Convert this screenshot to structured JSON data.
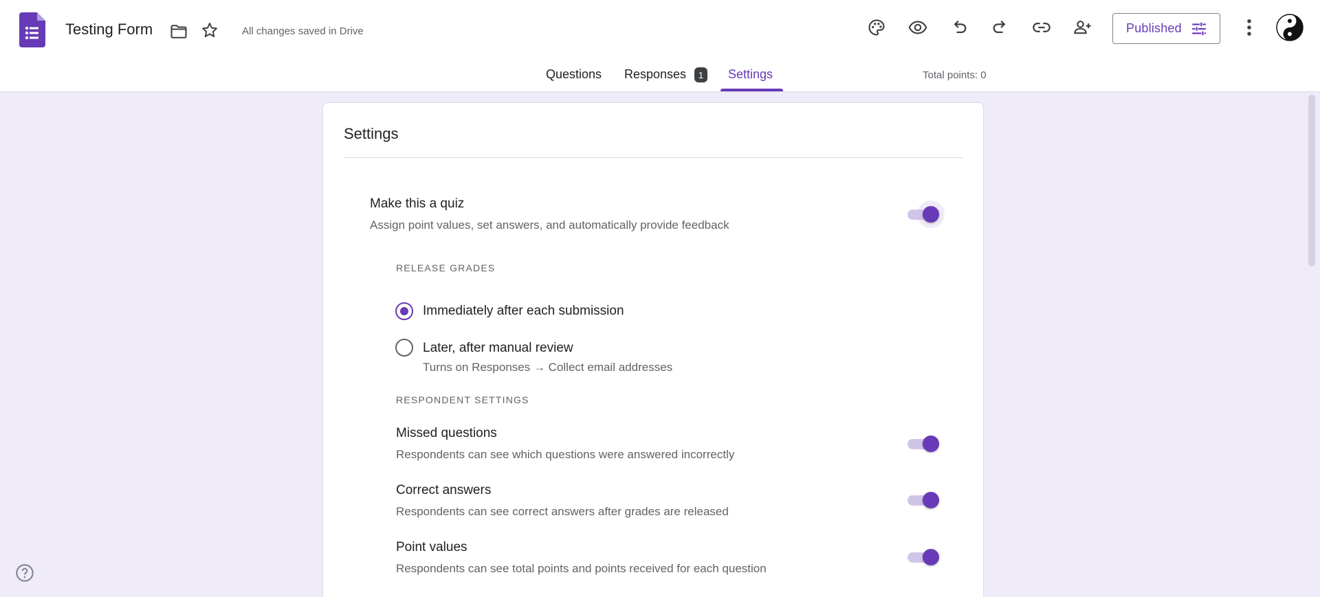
{
  "header": {
    "doc_title": "Testing Form",
    "save_status": "All changes saved in Drive",
    "publish_label": "Published",
    "icons": [
      "palette-icon",
      "preview-eye-icon",
      "undo-icon",
      "redo-icon",
      "link-icon",
      "add-collaborator-icon",
      "tune-icon",
      "more-vert-icon"
    ]
  },
  "tabs": {
    "questions": "Questions",
    "responses": "Responses",
    "responses_badge": "1",
    "settings": "Settings",
    "active": "Settings"
  },
  "total_points": "Total points: 0",
  "settings": {
    "title": "Settings",
    "quiz": {
      "title": "Make this a quiz",
      "subtitle": "Assign point values, set answers, and automatically provide feedback",
      "enabled": true
    },
    "release_grades": {
      "label": "RELEASE GRADES",
      "options": [
        {
          "label": "Immediately after each submission",
          "selected": true
        },
        {
          "label": "Later, after manual review",
          "sublabel": "Turns on Responses → Collect email addresses",
          "selected": false
        }
      ]
    },
    "respondent_settings": {
      "label": "RESPONDENT SETTINGS",
      "items": [
        {
          "title": "Missed questions",
          "subtitle": "Respondents can see which questions were answered incorrectly",
          "enabled": true
        },
        {
          "title": "Correct answers",
          "subtitle": "Respondents can see correct answers after grades are released",
          "enabled": true
        },
        {
          "title": "Point values",
          "subtitle": "Respondents can see total points and points received for each question",
          "enabled": true
        }
      ]
    }
  },
  "colors": {
    "accent": "#673ab7",
    "background": "#f0ebf8",
    "track": "#d1c4e9"
  }
}
